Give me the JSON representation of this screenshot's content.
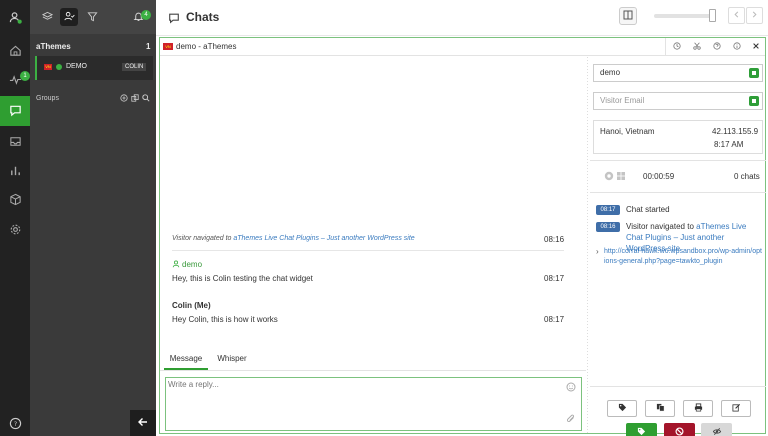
{
  "rail": {
    "activity_badge": "1"
  },
  "list": {
    "notif_count": "4",
    "group_name": "aThemes",
    "group_count": "1",
    "chat_flag": "VN",
    "chat_name": "DEMO",
    "chat_agent": "COLIN",
    "groups_label": "Groups"
  },
  "header": {
    "title": "Chats"
  },
  "tab": {
    "flag": "VN",
    "title": "demo - aThemes"
  },
  "conversation": {
    "navigated_prefix": "Visitor navigated to ",
    "navigated_link": "aThemes Live Chat Plugins – Just another WordPress site",
    "navigated_time": "08:16",
    "visitor_name": "demo",
    "visitor_msg": "Hey, this is Colin testing the chat widget",
    "visitor_time": "08:17",
    "agent_name": "Colin (Me)",
    "agent_msg": "Hey Colin, this is how it works",
    "agent_time": "08:17"
  },
  "composer": {
    "tab_message": "Message",
    "tab_whisper": "Whisper",
    "placeholder": "Write a reply..."
  },
  "visitor": {
    "name_value": "demo",
    "email_placeholder": "Visitor Email",
    "location": "Hanoi, Vietnam",
    "ip": "42.113.155.9",
    "local_time": "8:17 AM",
    "duration": "00:00:59",
    "chats": "0 chats"
  },
  "timeline": {
    "e1_time": "08:17",
    "e1_text": "Chat started",
    "e2_time": "08:16",
    "e2_prefix": "Visitor navigated to ",
    "e2_link": "aThemes Live Chat Plugins – Just another WordPress site",
    "url": "http://corral-hawk.w6.wpsandbox.pro/wp-admin/options-general.php?page=tawkto_plugin"
  },
  "colors": {
    "accent": "#2f9e31",
    "ban": "#a4142a",
    "link": "#3a7bbf"
  }
}
